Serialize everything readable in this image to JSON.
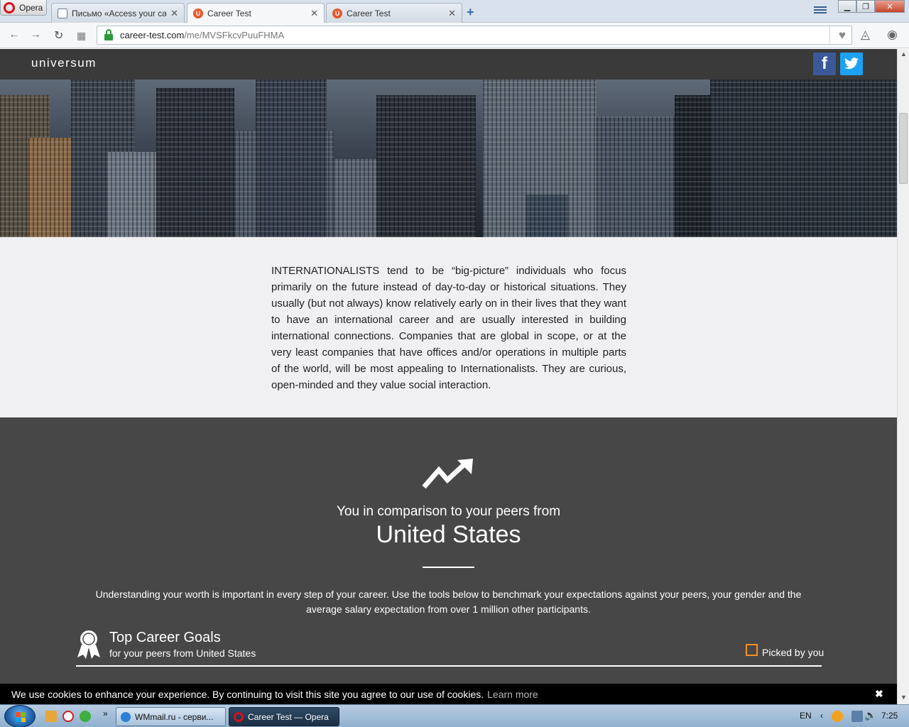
{
  "browser": {
    "menu_label": "Opera",
    "tabs": [
      {
        "title": "Письмо «Access your care",
        "close": "✕"
      },
      {
        "title": "Career Test",
        "close": "✕"
      },
      {
        "title": "Career Test",
        "close": "✕"
      }
    ],
    "new_tab": "+",
    "url_domain": "career-test.com",
    "url_path": "/me/MVSFkcvPuuFHMA"
  },
  "site": {
    "logo": "universum",
    "facebook_label": "f",
    "twitter_label": "t"
  },
  "intro": {
    "text": "INTERNATIONALISTS tend to be “big-picture” individuals who focus primarily on the future instead of day-to-day or historical situations. They usually (but not always) know relatively early on in their lives that they want to have an international career and are usually interested in building international connections. Companies that are global in scope, or at the very least companies that have offices and/or operations in multiple parts of the world, will be most appealing to Internationalists. They are curious, open-minded and they value social interaction."
  },
  "comparison": {
    "subtitle": "You in comparison to your peers from",
    "country": "United States",
    "description": "Understanding your worth is important in every step of your career. Use the tools below to benchmark your expectations against your peers, your gender and the average salary expectation from over 1 million other participants.",
    "goals_title": "Top Career Goals",
    "goals_subtitle": "for your peers from United States",
    "picked_label": "Picked by you"
  },
  "cookie": {
    "text": "We use cookies to enhance your experience. By continuing to visit this site you agree to our use of cookies.",
    "learn_more": "Learn more",
    "close": "✖"
  },
  "taskbar": {
    "items": [
      {
        "label": "WMmail.ru - серви..."
      },
      {
        "label": "Career Test — Opera"
      }
    ],
    "language": "EN",
    "time": "7:25"
  },
  "colors": {
    "accent_orange": "#f39020",
    "site_dark": "#3a3a3a",
    "section_gray": "#474747",
    "facebook": "#3b5998",
    "twitter": "#1da1f2"
  }
}
